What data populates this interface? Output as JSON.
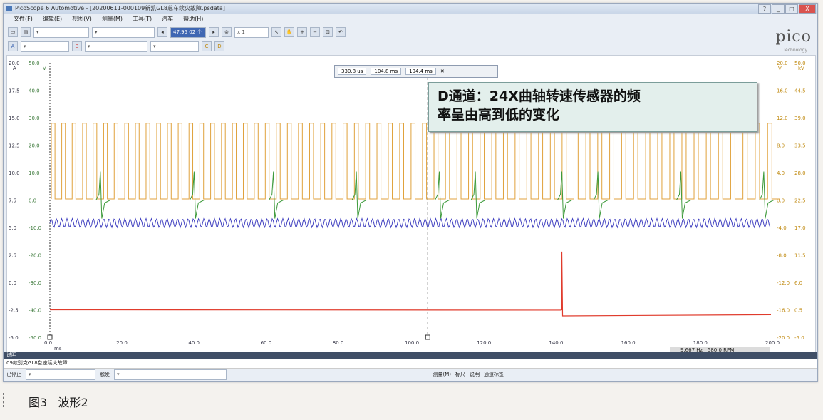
{
  "window": {
    "title": "PicoScope 6 Automotive - [20200611-000109新凯GL8怠车续火故障.psdata]",
    "buttons": {
      "help": "?",
      "min": "_",
      "max": "□",
      "close": "X"
    }
  },
  "menu": [
    "文件(F)",
    "编辑(E)",
    "视图(V)",
    "测量(M)",
    "工具(T)",
    "汽车",
    "帮助(H)"
  ],
  "toolbar": {
    "timebase": "47.95 02 个",
    "zoom": "x 1",
    "channel_a": "A",
    "channel_b": "B",
    "channel_c": "C",
    "channel_d": "D"
  },
  "logo": {
    "text": "pico",
    "sub": "Technology"
  },
  "ruler_box": {
    "t1": "330.8 us",
    "t2": "104.8 ms",
    "t3": "104.4 ms"
  },
  "annotation": {
    "line1": "D通道：24X曲轴转速传感器的频",
    "line2": "率呈由高到低的变化"
  },
  "axes": {
    "left_a_unit": "A",
    "left_b_unit": "V",
    "right_c_unit": "V",
    "right_d_unit": "kV",
    "x_unit": "ms",
    "left_a_ticks": [
      "20.0",
      "17.5",
      "15.0",
      "12.5",
      "10.0",
      "7.5",
      "5.0",
      "2.5",
      "0.0",
      "-2.5",
      "-5.0"
    ],
    "left_b_ticks": [
      "50.0",
      "40.0",
      "30.0",
      "20.0",
      "10.0",
      "0.0",
      "-10.0",
      "-20.0",
      "-30.0",
      "-40.0",
      "-50.0"
    ],
    "right_c_ticks": [
      "20.0",
      "16.0",
      "12.0",
      "8.0",
      "4.0",
      "0.0",
      "-4.0",
      "-8.0",
      "-12.0",
      "-16.0",
      "-20.0"
    ],
    "right_d_ticks": [
      "50.0",
      "44.5",
      "39.0",
      "33.5",
      "28.0",
      "22.5",
      "17.0",
      "11.5",
      "6.0",
      "0.5",
      "-5.0"
    ],
    "x_ticks": [
      "0.0",
      "20.0",
      "40.0",
      "60.0",
      "80.0",
      "100.0",
      "120.0",
      "140.0",
      "160.0",
      "180.0",
      "200.0"
    ]
  },
  "chart_data": {
    "type": "line",
    "x_range_ms": [
      0,
      200
    ],
    "series": [
      {
        "color": "#e0a23c",
        "square_high": 14.5,
        "square_low": 7.6,
        "pulse_count": 64
      },
      {
        "color": "#3d9a3b",
        "spikes_x_ms": [
          14,
          40,
          62,
          85,
          108,
          118,
          142,
          152,
          175,
          198
        ],
        "baseline": 7.5
      },
      {
        "color": "#4040c0",
        "baseline": 5.4,
        "amplitude": 0.4
      },
      {
        "color": "#e03b2c",
        "low_before": -2.5,
        "step_x_ms": 142,
        "step_high": 2.8,
        "low_after": -3.05
      }
    ],
    "cursor_ms": 104.8
  },
  "status": {
    "freq": "9.667 Hz",
    "rpm": "580.0 RPM"
  },
  "desc_bar": {
    "label": "说明",
    "note": "09款别克GL8怠速续火故障"
  },
  "bottom_bar": {
    "status": "已停止",
    "trigger": "触发",
    "measure": "测量(M)",
    "ruler": "标尺",
    "notes": "说明",
    "channels": "通道标签"
  },
  "caption": {
    "fig": "图3",
    "title": "波形2"
  }
}
